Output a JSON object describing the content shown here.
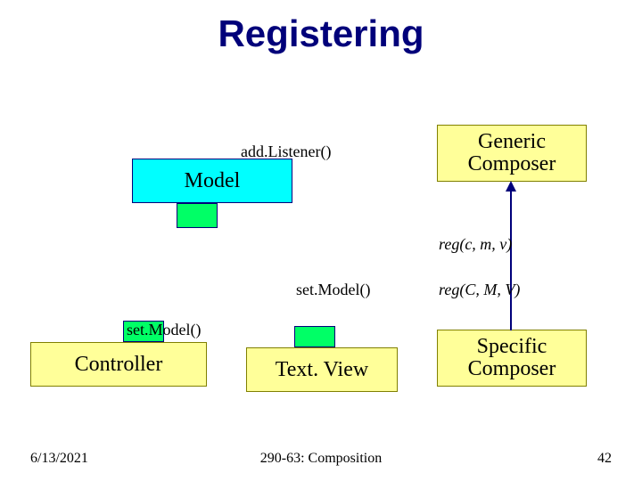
{
  "title": "Registering",
  "boxes": {
    "model": "Model",
    "controller": "Controller",
    "textview": "Text. View",
    "generic_line1": "Generic",
    "generic_line2": "Composer",
    "specific_line1": "Specific",
    "specific_line2": "Composer"
  },
  "labels": {
    "add_listener": "add.Listener()",
    "set_model_right": "set.Model()",
    "set_model_left": "set.Model()",
    "reg_lower": "reg(c, m, v)",
    "reg_upper": "reg(C, M, V)"
  },
  "footer": {
    "date": "6/13/2021",
    "center": "290-63: Composition",
    "pagenum": "42"
  }
}
